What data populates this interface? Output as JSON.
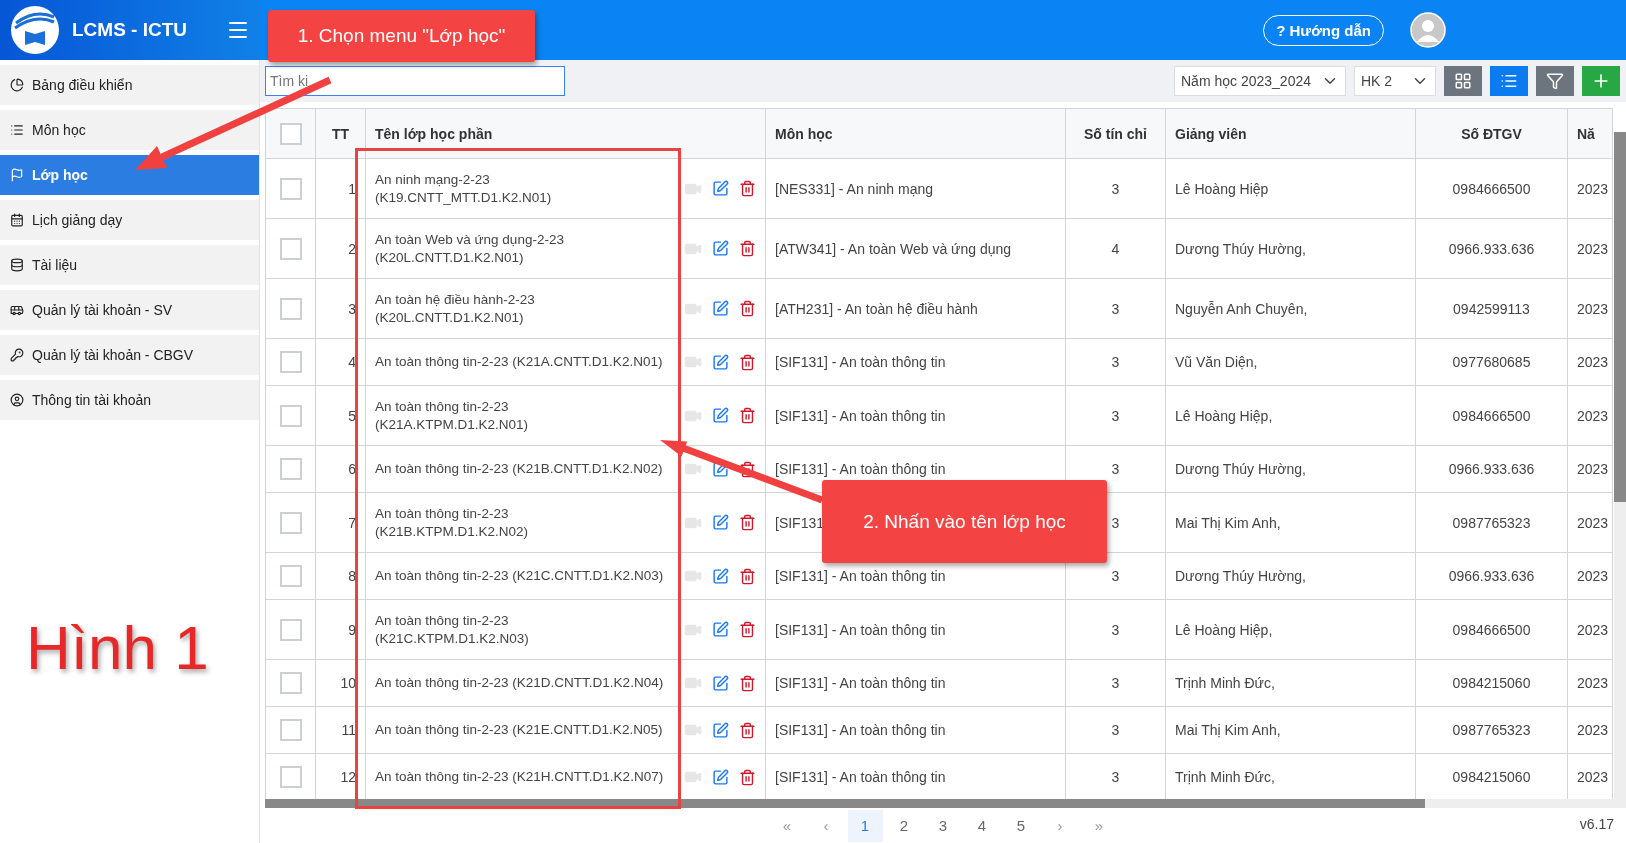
{
  "header": {
    "brand": "LCMS - ICTU",
    "help_button": "? Hướng dẫn"
  },
  "sidebar": {
    "items": [
      {
        "label": "Bảng điều khiển",
        "selected": false
      },
      {
        "label": "Môn học",
        "selected": false
      },
      {
        "label": "Lớp học",
        "selected": true
      },
      {
        "label": "Lịch giảng dạy",
        "selected": false
      },
      {
        "label": "Tài liệu",
        "selected": false
      },
      {
        "label": "Quản lý tài khoản - SV",
        "selected": false
      },
      {
        "label": "Quản lý tài khoản - CBGV",
        "selected": false
      },
      {
        "label": "Thông tin tài khoản",
        "selected": false
      }
    ]
  },
  "toolbar": {
    "search": {
      "placeholder": "Tìm ki"
    },
    "year_select": "Năm học 2023_2024",
    "term_select": "HK 2",
    "views": [
      {
        "kind": "grid",
        "selected": false
      },
      {
        "kind": "list",
        "selected": true
      }
    ]
  },
  "table": {
    "select_all": {
      "checked": false
    },
    "columns": [
      "TT",
      "Tên lớp học phần",
      "Môn học",
      "Số tín chỉ",
      "Giảng viên",
      "Số ĐTGV",
      "Nă"
    ],
    "rows": [
      {
        "checked": false,
        "tt": "1",
        "name": [
          "An ninh mạng-2-23",
          "(K19.CNTT_MTT.D1.K2.N01)"
        ],
        "subject": "[NES331] - An ninh mạng",
        "credits": "3",
        "lecturer": "Lê Hoàng Hiệp",
        "phone": "0984666500",
        "year": "2023"
      },
      {
        "checked": false,
        "tt": "2",
        "name": [
          "An toàn Web và ứng dụng-2-23",
          "(K20L.CNTT.D1.K2.N01)"
        ],
        "subject": "[ATW341] - An toàn Web và ứng dụng",
        "credits": "4",
        "lecturer": "Dương Thúy Hường,",
        "phone": "0966.933.636",
        "year": "2023"
      },
      {
        "checked": false,
        "tt": "3",
        "name": [
          "An toàn hệ điều hành-2-23",
          "(K20L.CNTT.D1.K2.N01)"
        ],
        "subject": "[ATH231] - An toàn hệ điều hành",
        "credits": "3",
        "lecturer": "Nguyễn Anh Chuyên,",
        "phone": "0942599113",
        "year": "2023"
      },
      {
        "checked": false,
        "tt": "4",
        "name": [
          "An toàn thông tin-2-23 (K21A.CNTT.D1.K2.N01)"
        ],
        "subject": "[SIF131] - An toàn thông tin",
        "credits": "3",
        "lecturer": "Vũ Văn Diện,",
        "phone": "0977680685",
        "year": "2023"
      },
      {
        "checked": false,
        "tt": "5",
        "name": [
          "An toàn thông tin-2-23",
          "(K21A.KTPM.D1.K2.N01)"
        ],
        "subject": "[SIF131] - An toàn thông tin",
        "credits": "3",
        "lecturer": "Lê Hoàng Hiệp,",
        "phone": "0984666500",
        "year": "2023"
      },
      {
        "checked": false,
        "tt": "6",
        "name": [
          "An toàn thông tin-2-23 (K21B.CNTT.D1.K2.N02)"
        ],
        "subject": "[SIF131] - An toàn thông tin",
        "credits": "3",
        "lecturer": "Dương Thúy Hường,",
        "phone": "0966.933.636",
        "year": "2023"
      },
      {
        "checked": false,
        "tt": "7",
        "name": [
          "An toàn thông tin-2-23",
          "(K21B.KTPM.D1.K2.N02)"
        ],
        "subject": "[SIF131",
        "credits": "3",
        "lecturer": "Mai Thị Kim Anh,",
        "phone": "0987765323",
        "year": "2023"
      },
      {
        "checked": false,
        "tt": "8",
        "name": [
          "An toàn thông tin-2-23 (K21C.CNTT.D1.K2.N03)"
        ],
        "subject": "[SIF131] - An toàn thông tin",
        "credits": "3",
        "lecturer": "Dương Thúy Hường,",
        "phone": "0966.933.636",
        "year": "2023"
      },
      {
        "checked": false,
        "tt": "9",
        "name": [
          "An toàn thông tin-2-23",
          "(K21C.KTPM.D1.K2.N03)"
        ],
        "subject": "[SIF131] - An toàn thông tin",
        "credits": "3",
        "lecturer": "Lê Hoàng Hiệp,",
        "phone": "0984666500",
        "year": "2023"
      },
      {
        "checked": false,
        "tt": "10",
        "name": [
          "An toàn thông tin-2-23 (K21D.CNTT.D1.K2.N04)"
        ],
        "subject": "[SIF131] - An toàn thông tin",
        "credits": "3",
        "lecturer": "Trịnh Minh Đức,",
        "phone": "0984215060",
        "year": "2023"
      },
      {
        "checked": false,
        "tt": "11",
        "name": [
          "An toàn thông tin-2-23 (K21E.CNTT.D1.K2.N05)"
        ],
        "subject": "[SIF131] - An toàn thông tin",
        "credits": "3",
        "lecturer": "Mai Thị Kim Anh,",
        "phone": "0987765323",
        "year": "2023"
      },
      {
        "checked": false,
        "tt": "12",
        "name": [
          "An toàn thông tin-2-23 (K21H.CNTT.D1.K2.N07)"
        ],
        "subject": "[SIF131] - An toàn thông tin",
        "credits": "3",
        "lecturer": "Trịnh Minh Đức,",
        "phone": "0984215060",
        "year": "2023"
      }
    ]
  },
  "pagination": {
    "pages": [
      {
        "label": "«",
        "kind": "nav",
        "selected": false
      },
      {
        "label": "‹",
        "kind": "nav",
        "selected": false
      },
      {
        "label": "1",
        "kind": "page",
        "selected": true
      },
      {
        "label": "2",
        "kind": "page",
        "selected": false
      },
      {
        "label": "3",
        "kind": "page",
        "selected": false
      },
      {
        "label": "4",
        "kind": "page",
        "selected": false
      },
      {
        "label": "5",
        "kind": "page",
        "selected": false
      },
      {
        "label": "›",
        "kind": "nav",
        "selected": false
      },
      {
        "label": "»",
        "kind": "nav",
        "selected": false
      }
    ],
    "version": "v6.17"
  },
  "annotations": {
    "callout_1": "1. Chọn menu \"Lớp học\"",
    "callout_2": "2. Nhấn vào tên lớp học",
    "figure_label": "Hình 1"
  }
}
